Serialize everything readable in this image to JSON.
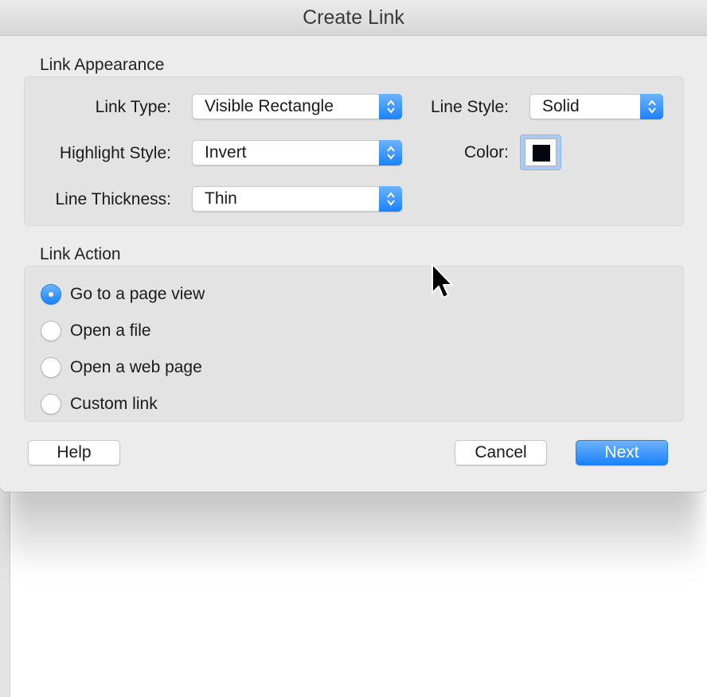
{
  "dialog": {
    "title": "Create Link"
  },
  "appearance": {
    "section_title": "Link Appearance",
    "link_type": {
      "label": "Link Type:",
      "value": "Visible Rectangle"
    },
    "line_style": {
      "label": "Line Style:",
      "value": "Solid"
    },
    "highlight_style": {
      "label": "Highlight Style:",
      "value": "Invert"
    },
    "color": {
      "label": "Color:",
      "value": "#050510"
    },
    "line_thickness": {
      "label": "Line Thickness:",
      "value": "Thin"
    }
  },
  "action": {
    "section_title": "Link Action",
    "options": [
      {
        "label": "Go to a page view",
        "selected": true
      },
      {
        "label": "Open a file",
        "selected": false
      },
      {
        "label": "Open a web page",
        "selected": false
      },
      {
        "label": "Custom link",
        "selected": false
      }
    ]
  },
  "buttons": {
    "help": "Help",
    "cancel": "Cancel",
    "next": "Next"
  },
  "colors": {
    "accent": "#1a82fb",
    "dialog_bg": "#ececec",
    "group_bg": "#e3e3e3"
  },
  "icons": {
    "popup_stepper": "up-down-chevron-icon",
    "pointer": "arrow-cursor-icon"
  }
}
